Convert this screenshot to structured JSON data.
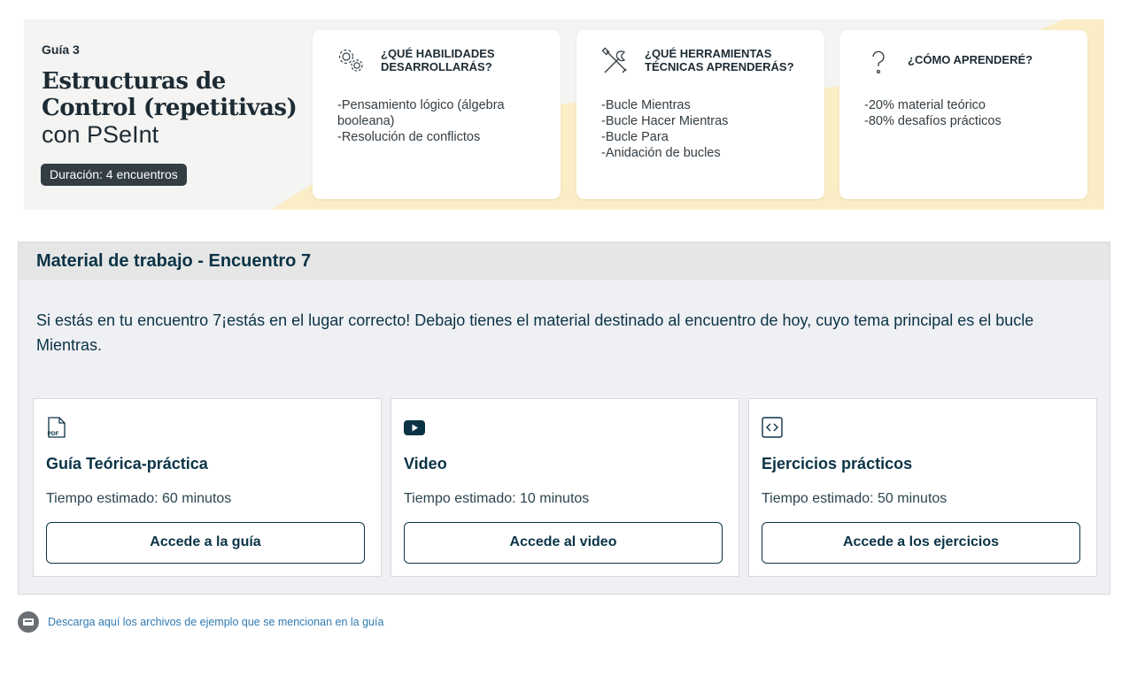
{
  "banner": {
    "guide_number": "Guía 3",
    "title": "Estructuras de Control (repetitivas)",
    "subtitle": "con PSeInt",
    "duration": "Duración: 4 encuentros",
    "cards": [
      {
        "icon": "gears-icon",
        "heading": "¿QUÉ HABILIDADES DESARROLLARÁS?",
        "lines": [
          "-Pensamiento lógico (álgebra booleana)",
          "-Resolución de conflictos"
        ]
      },
      {
        "icon": "tools-icon",
        "heading": "¿QUÉ HERRAMIENTAS TÉCNICAS APRENDERÁS?",
        "lines": [
          "-Bucle Mientras",
          "-Bucle Hacer Mientras",
          "-Bucle Para",
          "-Anidación de bucles"
        ]
      },
      {
        "icon": "question-icon",
        "heading": "¿CÓMO APRENDERÉ?",
        "lines": [
          "-20% material teórico",
          "-80% desafíos prácticos"
        ]
      }
    ],
    "colors": {
      "accent_yellow": "#fbeec6",
      "text_dark": "#1d2b34"
    }
  },
  "material": {
    "header": "Material de trabajo - Encuentro 7",
    "intro": "Si estás en tu encuentro 7¡estás en el lugar correcto! Debajo tienes el material destinado al encuentro de hoy, cuyo tema principal es el bucle Mientras.",
    "cards": [
      {
        "icon": "pdf-icon",
        "title": "Guía Teórica-práctica",
        "time": "Tiempo estimado: 60 minutos",
        "button": "Accede a la guía"
      },
      {
        "icon": "youtube-icon",
        "title": "Video",
        "time": "Tiempo estimado: 10 minutos",
        "button": "Accede al video"
      },
      {
        "icon": "code-icon",
        "title": "Ejercicios prácticos",
        "time": "Tiempo estimado: 50 minutos",
        "button": "Accede a los ejercicios"
      }
    ],
    "colors": {
      "primary": "#0b3346",
      "section_bg": "#eff0f4",
      "header_bg": "#e6e6e6"
    }
  },
  "download": {
    "icon": "download-folder-icon",
    "label": "Descarga aquí los archivos de ejemplo que se mencionan en la guía",
    "color": "#2f7ab2"
  }
}
